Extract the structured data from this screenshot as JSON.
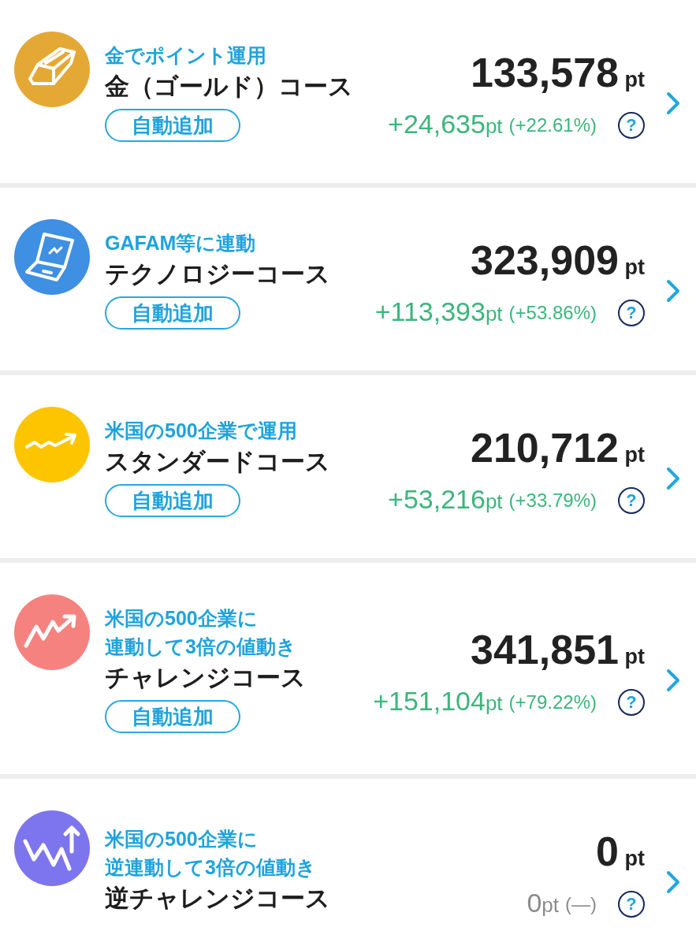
{
  "courses": [
    {
      "subtitle_lines": [
        "金でポイント運用"
      ],
      "title": "金（ゴールド）コース",
      "badge": "自動追加",
      "points": "133,578",
      "points_unit": "pt",
      "change": "+24,635",
      "change_unit": "pt",
      "change_rate": "(+22.61%)",
      "gain": true,
      "help": "?",
      "color": "#e4a835"
    },
    {
      "subtitle_lines": [
        "GAFAM等に連動"
      ],
      "title": "テクノロジーコース",
      "badge": "自動追加",
      "points": "323,909",
      "points_unit": "pt",
      "change": "+113,393",
      "change_unit": "pt",
      "change_rate": "(+53.86%)",
      "gain": true,
      "help": "?",
      "color": "#3f8fe2"
    },
    {
      "subtitle_lines": [
        "米国の500企業で運用"
      ],
      "title": "スタンダードコース",
      "badge": "自動追加",
      "points": "210,712",
      "points_unit": "pt",
      "change": "+53,216",
      "change_unit": "pt",
      "change_rate": "(+33.79%)",
      "gain": true,
      "help": "?",
      "color": "#fdc500"
    },
    {
      "subtitle_lines": [
        "米国の500企業に",
        "連動して3倍の値動き"
      ],
      "title": "チャレンジコース",
      "badge": "自動追加",
      "points": "341,851",
      "points_unit": "pt",
      "change": "+151,104",
      "change_unit": "pt",
      "change_rate": "(+79.22%)",
      "gain": true,
      "help": "?",
      "color": "#f6827f"
    },
    {
      "subtitle_lines": [
        "米国の500企業に",
        "逆連動して3倍の値動き"
      ],
      "title": "逆チャレンジコース",
      "points": "0",
      "points_unit": "pt",
      "change": "0",
      "change_unit": "pt",
      "change_rate": "(—)",
      "gain": false,
      "help": "?",
      "color": "#7d75ee"
    }
  ]
}
